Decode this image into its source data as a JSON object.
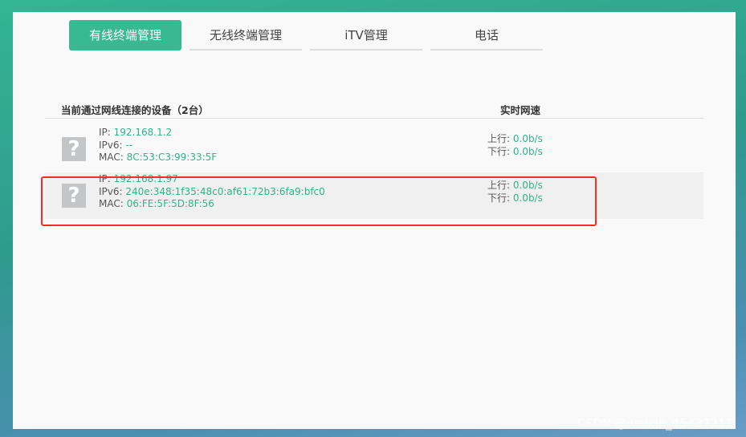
{
  "tabs": [
    {
      "label": "有线终端管理",
      "active": true
    },
    {
      "label": "无线终端管理"
    },
    {
      "label": "iTV管理"
    },
    {
      "label": "电话"
    }
  ],
  "table": {
    "title": "当前通过网线连接的设备（2台）",
    "speed_header": "实时网速"
  },
  "labels": {
    "ip": "IP: ",
    "ipv6": "IPv6: ",
    "mac": "MAC: ",
    "up": "上行: ",
    "down": "下行: "
  },
  "devices": [
    {
      "icon": "unknown-device-icon",
      "ip": "192.168.1.2",
      "ipv6": "--",
      "mac": "8C:53:C3:99:33:5F",
      "up": "0.0b/s",
      "down": "0.0b/s"
    },
    {
      "icon": "unknown-device-icon",
      "ip": "192.168.1.97",
      "ipv6": "240e:348:1f35:48c0:af61:72b3:6fa9:bfc0",
      "mac": "06:FE:5F:5D:8F:56",
      "up": "0.0b/s",
      "down": "0.0b/s"
    }
  ],
  "watermark": "CSDN @weixin_45437211"
}
